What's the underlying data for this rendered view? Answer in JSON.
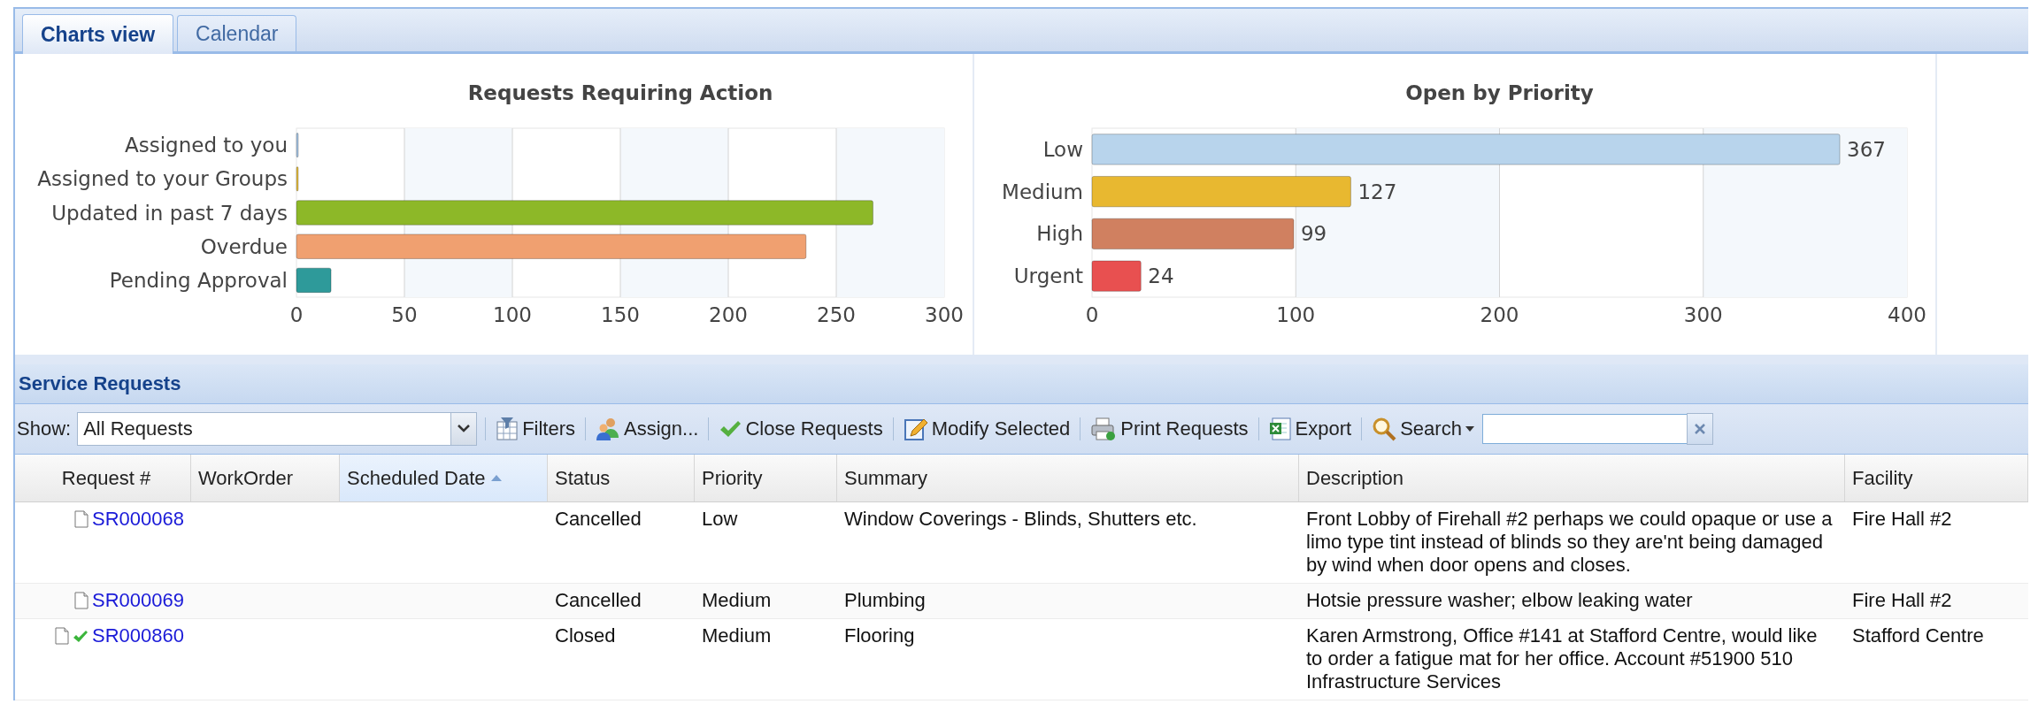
{
  "tabs": [
    {
      "label": "Charts view",
      "selected": true
    },
    {
      "label": "Calendar",
      "selected": false
    }
  ],
  "charts": [
    {
      "chart_data": {
        "type": "bar",
        "orientation": "horizontal",
        "title": "Requests Requiring Action",
        "categories": [
          "Assigned to you",
          "Assigned to your Groups",
          "Updated in past 7 days",
          "Overdue",
          "Pending Approval"
        ],
        "grid": true,
        "series": [
          {
            "color": "#a8c8e8",
            "values": [
              0,
              null,
              null,
              null,
              null
            ]
          },
          {
            "color": "#e8c040",
            "values": [
              null,
              0,
              null,
              null,
              null
            ]
          },
          {
            "color": "#8db828",
            "values": [
              null,
              null,
              267,
              null,
              null
            ]
          },
          {
            "color": "#f0a070",
            "values": [
              null,
              null,
              null,
              236,
              null
            ]
          },
          {
            "color": "#2e9a9a",
            "values": [
              null,
              null,
              null,
              null,
              16
            ]
          }
        ],
        "xlim": [
          0,
          300
        ],
        "xticks": [
          0,
          50,
          100,
          150,
          200,
          250,
          300
        ]
      }
    },
    {
      "chart_data": {
        "type": "bar",
        "orientation": "horizontal",
        "title": "Open by Priority",
        "categories": [
          "Low",
          "Medium",
          "High",
          "Urgent"
        ],
        "grid": true,
        "series": [
          {
            "color": "#b8d4ec",
            "values": [
              367,
              null,
              null,
              null
            ]
          },
          {
            "color": "#e8b830",
            "values": [
              null,
              127,
              null,
              null
            ]
          },
          {
            "color": "#d08060",
            "values": [
              null,
              null,
              99,
              null
            ]
          },
          {
            "color": "#e85050",
            "values": [
              null,
              null,
              null,
              24
            ]
          }
        ],
        "xlim": [
          0,
          400
        ],
        "xticks": [
          0,
          100,
          200,
          300,
          400
        ],
        "data_labels": true
      }
    }
  ],
  "panel": {
    "title": "Service Requests"
  },
  "toolbar": {
    "show_label": "Show:",
    "show_value": "All Requests",
    "buttons": [
      {
        "kind": "filters",
        "label": "Filters"
      },
      {
        "kind": "assign",
        "label": "Assign..."
      },
      {
        "kind": "close",
        "label": "Close Requests"
      },
      {
        "kind": "modify",
        "label": "Modify Selected"
      },
      {
        "kind": "print",
        "label": "Print Requests"
      },
      {
        "kind": "export",
        "label": "Export"
      },
      {
        "kind": "search",
        "label": "Search"
      }
    ]
  },
  "table": {
    "columns": [
      {
        "label": "Request #",
        "sorted": false
      },
      {
        "label": "WorkOrder",
        "sorted": false
      },
      {
        "label": "Scheduled Date",
        "sorted": true
      },
      {
        "label": "Status",
        "sorted": false
      },
      {
        "label": "Priority",
        "sorted": false
      },
      {
        "label": "Summary",
        "sorted": false
      },
      {
        "label": "Description",
        "sorted": false
      },
      {
        "label": "Facility",
        "sorted": false
      }
    ],
    "rows": [
      {
        "request": "SR000068",
        "closed": false,
        "status": "Cancelled",
        "priority": "Low",
        "summary": "Window Coverings - Blinds, Shutters etc.",
        "description": "Front Lobby of Firehall #2 perhaps we could opaque or use a limo type tint instead of blinds so they are'nt being damaged by wind when door opens and closes.",
        "facility": "Fire Hall #2"
      },
      {
        "request": "SR000069",
        "closed": false,
        "status": "Cancelled",
        "priority": "Medium",
        "summary": "Plumbing",
        "description": "Hotsie pressure washer; elbow leaking water",
        "facility": "Fire Hall #2"
      },
      {
        "request": "SR000860",
        "closed": true,
        "status": "Closed",
        "priority": "Medium",
        "summary": "Flooring",
        "description": "Karen Armstrong, Office #141 at Stafford Centre, would like to order a fatigue mat for her office. Account #51900 510 Infrastructure Services",
        "facility": "Stafford Centre"
      }
    ]
  }
}
